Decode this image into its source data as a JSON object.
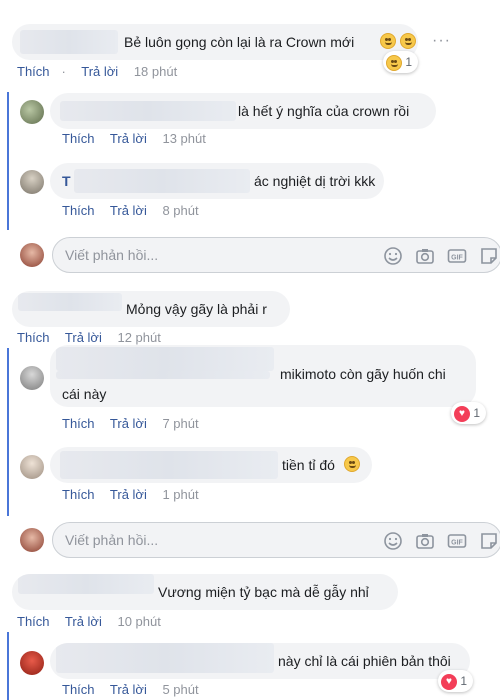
{
  "labels": {
    "like": "Thích",
    "reply": "Trả lời"
  },
  "reply_placeholder": "Viết phản hồi...",
  "comments": [
    {
      "text": "Bẻ luôn gọng còn lại là ra Crown mới",
      "time": "18 phút",
      "reaction_count": "1",
      "reaction": "laugh"
    },
    {
      "text": "là hết ý nghĩa của crown rồi",
      "time": "13 phút"
    },
    {
      "name_initial": "T",
      "text": "ác nghiệt dị trời kkk",
      "time": "8 phút"
    },
    {
      "text": "Mỏng vậy gãy là phải r",
      "time": "12 phút"
    },
    {
      "text_line1": "mikimoto còn gãy huốn chi",
      "text_line2": "cái này",
      "time": "7 phút",
      "reaction_count": "1",
      "reaction": "love"
    },
    {
      "text": "tiền tỉ đó",
      "time": "1 phút"
    },
    {
      "text": "Vương miện tỷ bạc mà dễ gẫy nhỉ",
      "time": "10 phút"
    },
    {
      "text": "này chỉ là cái phiên bản thôi",
      "time": "5 phút",
      "reaction_count": "1",
      "reaction": "love"
    }
  ],
  "icons": [
    "emoji-icon",
    "camera-icon",
    "gif-icon",
    "sticker-icon",
    "more-options-icon"
  ],
  "colors": {
    "link": "#365899",
    "thread_line": "#4a76d8",
    "bubble": "#f2f3f5",
    "love": "#f33e58"
  }
}
